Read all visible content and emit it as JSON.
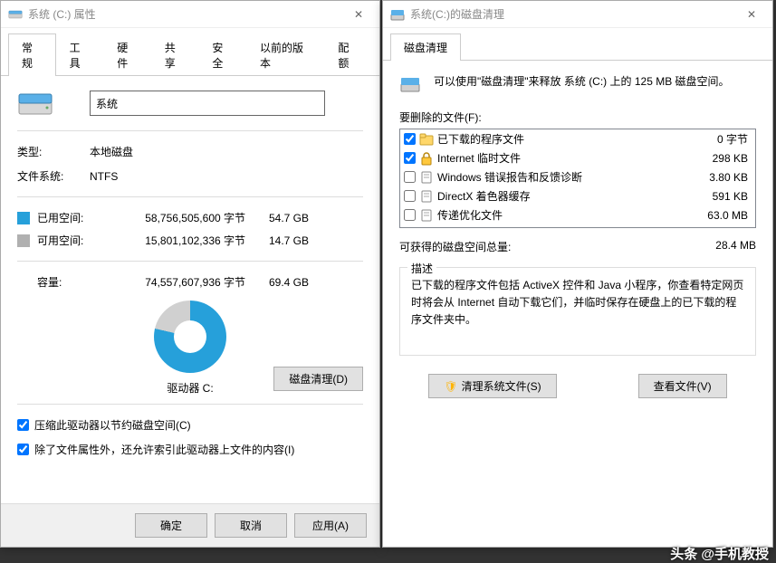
{
  "properties": {
    "title": "系统 (C:) 属性",
    "tabs": [
      "常规",
      "工具",
      "硬件",
      "共享",
      "安全",
      "以前的版本",
      "配额"
    ],
    "drive_name": "系统",
    "type_label": "类型:",
    "type_value": "本地磁盘",
    "fs_label": "文件系统:",
    "fs_value": "NTFS",
    "used_label": "已用空间:",
    "used_bytes": "58,756,505,600 字节",
    "used_gb": "54.7 GB",
    "free_label": "可用空间:",
    "free_bytes": "15,801,102,336 字节",
    "free_gb": "14.7 GB",
    "capacity_label": "容量:",
    "capacity_bytes": "74,557,607,936 字节",
    "capacity_gb": "69.4 GB",
    "drive_caption": "驱动器 C:",
    "cleanup_btn": "磁盘清理(D)",
    "compress_cb": "压缩此驱动器以节约磁盘空间(C)",
    "index_cb": "除了文件属性外，还允许索引此驱动器上文件的内容(I)",
    "ok": "确定",
    "cancel": "取消",
    "apply": "应用(A)"
  },
  "cleanup": {
    "title": "系统(C:)的磁盘清理",
    "tab": "磁盘清理",
    "info_text": "可以使用\"磁盘清理\"来释放 系统 (C:) 上的 125 MB 磁盘空间。",
    "files_label": "要删除的文件(F):",
    "items": [
      {
        "checked": true,
        "name": "已下载的程序文件",
        "size": "0 字节",
        "icon": "folder"
      },
      {
        "checked": true,
        "name": "Internet 临时文件",
        "size": "298 KB",
        "icon": "lock"
      },
      {
        "checked": false,
        "name": "Windows 错误报告和反馈诊断",
        "size": "3.80 KB",
        "icon": "file"
      },
      {
        "checked": false,
        "name": "DirectX 着色器缓存",
        "size": "591 KB",
        "icon": "file"
      },
      {
        "checked": false,
        "name": "传递优化文件",
        "size": "63.0 MB",
        "icon": "file"
      }
    ],
    "total_label": "可获得的磁盘空间总量:",
    "total_value": "28.4 MB",
    "desc_legend": "描述",
    "desc_text": "已下载的程序文件包括 ActiveX 控件和 Java 小程序，你查看特定网页时将会从 Internet 自动下载它们，并临时保存在硬盘上的已下载的程序文件夹中。",
    "clean_sys_btn": "清理系统文件(S)",
    "view_files_btn": "查看文件(V)"
  },
  "watermark": "头条 @手机教授"
}
